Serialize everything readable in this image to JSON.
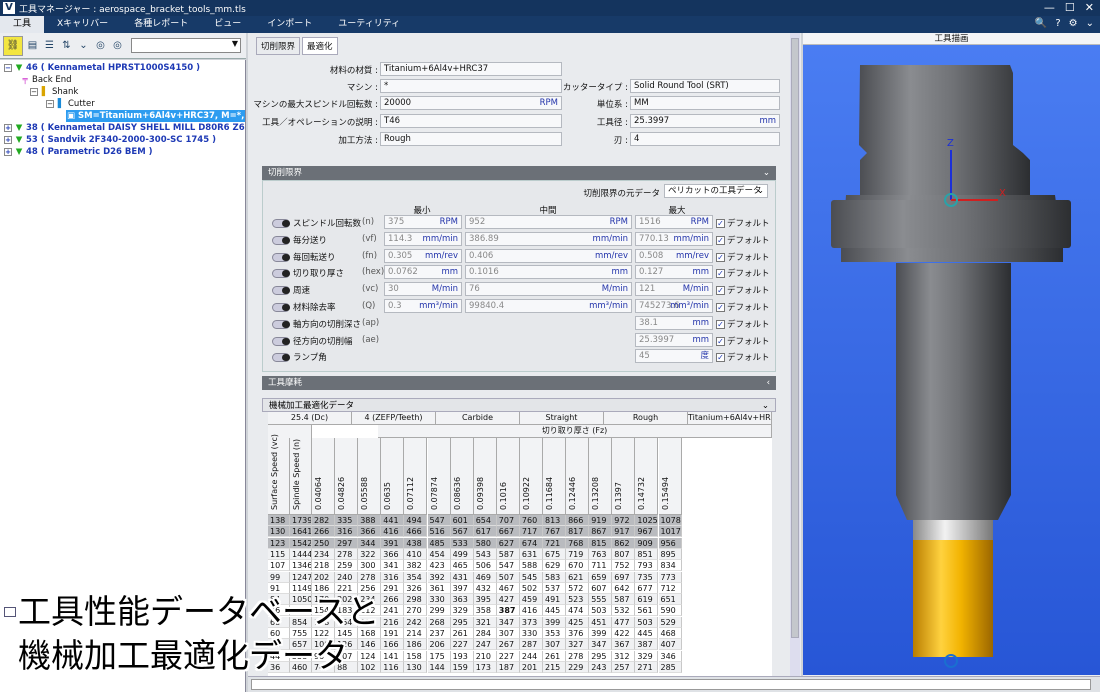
{
  "window": {
    "title": "工具マネージャー : aerospace_bracket_tools_mm.tls"
  },
  "menu": [
    "工具",
    "Xキャリバー",
    "各種レポート",
    "ビュー",
    "インポート",
    "ユーティリティ"
  ],
  "tree": [
    {
      "label": "46 ( Kennametal HPRST1000S4150 )",
      "level": 0,
      "style": "blue",
      "icon": "▼"
    },
    {
      "label": "Back End",
      "level": 1,
      "style": "",
      "icon": "╤"
    },
    {
      "label": "Shank",
      "level": 2,
      "style": "",
      "icon": "▌"
    },
    {
      "label": "Cutter",
      "level": 3,
      "style": "",
      "icon": "▌"
    },
    {
      "label": "SM=Titanium+6Al4v+HRC37, M=*, TO=T46",
      "level": 4,
      "style": "sel",
      "icon": "▣"
    },
    {
      "label": "38 ( Kennametal DAISY SHELL MILL D80R6 Z6 D27 RP120...",
      "level": 0,
      "style": "blue",
      "icon": "▼"
    },
    {
      "label": "53 ( Sandvik 2F340-2000-300-SC 1745 )",
      "level": 0,
      "style": "blue",
      "icon": "▼"
    },
    {
      "label": "48 ( Parametric D26 BEM )",
      "level": 0,
      "style": "blue",
      "icon": "▼"
    }
  ],
  "overlay": {
    "line1": "工具性能データベースと",
    "line2": "機械加工最適化データ"
  },
  "tabs": [
    "切削限界",
    "最適化"
  ],
  "form": {
    "material_label": "材料の材質 :",
    "material": "Titanium+6Al4v+HRC37",
    "machine_label": "マシン :",
    "machine": "*",
    "cutter_type_label": "カッタータイプ :",
    "cutter_type": "Solid Round Tool (SRT)",
    "max_spindle_label": "マシンの最大スピンドル回転数 :",
    "max_spindle": "20000",
    "max_spindle_unit": "RPM",
    "unit_label": "単位系 :",
    "unit": "MM",
    "desc_label": "工具／オペレーションの説明 :",
    "desc": "T46",
    "diameter_label": "工具径 :",
    "diameter": "25.3997",
    "diameter_unit": "mm",
    "method_label": "加工方法 :",
    "method": "Rough",
    "flutes_label": "刃 :",
    "flutes": "4"
  },
  "limits": {
    "title": "切削限界",
    "source_label": "切削限界の元データ",
    "source": "ペリカットの工具データ",
    "col_min": "最小",
    "col_mid": "中間",
    "col_max": "最大",
    "default_label": "デフォルト",
    "rows": [
      {
        "name": "スピンドル回転数",
        "sym": "(n)",
        "min": "375",
        "mid": "952",
        "max": "1516",
        "unit": "RPM"
      },
      {
        "name": "毎分送り",
        "sym": "(vf)",
        "min": "114.3",
        "mid": "386.89",
        "max": "770.13",
        "unit": "mm/min"
      },
      {
        "name": "毎回転送り",
        "sym": "(fn)",
        "min": "0.305",
        "mid": "0.406",
        "max": "0.508",
        "unit": "mm/rev"
      },
      {
        "name": "切り取り厚さ",
        "sym": "(hex)",
        "min": "0.0762",
        "mid": "0.1016",
        "max": "0.127",
        "unit": "mm"
      },
      {
        "name": "周速",
        "sym": "(vc)",
        "min": "30",
        "mid": "76",
        "max": "121",
        "unit": "M/min"
      },
      {
        "name": "材料除去率",
        "sym": "(Q)",
        "min": "0.3",
        "mid": "99840.4",
        "max": "745273.6",
        "unit": "mm³/min"
      },
      {
        "name": "軸方向の切削深さ",
        "sym": "(ap)",
        "min": "",
        "mid": "",
        "max": "38.1",
        "unit": "mm"
      },
      {
        "name": "径方向の切削幅",
        "sym": "(ae)",
        "min": "",
        "mid": "",
        "max": "25.3997",
        "unit": "mm"
      },
      {
        "name": "ランプ角",
        "sym": "",
        "min": "",
        "mid": "",
        "max": "45",
        "unit": "度"
      }
    ]
  },
  "wear": {
    "title": "工具摩耗"
  },
  "opt": {
    "title": "機械加工最適化データ",
    "info": [
      "25.4 (Dc)",
      "4 (ZEFP/Teeth)",
      "Carbide",
      "Straight",
      "Rough",
      "Titanium+6Al4v+HR..."
    ],
    "fz_label": "切り取り厚さ (Fz)",
    "col_vc": "Surface Speed (vc)",
    "col_n": "Spindle Speed (n)",
    "fz": [
      "0.04064",
      "0.04826",
      "0.05588",
      "0.0635",
      "0.07112",
      "0.07874",
      "0.08636",
      "0.09398",
      "0.1016",
      "0.10922",
      "0.11684",
      "0.12446",
      "0.13208",
      "0.1397",
      "0.14732",
      "0.15494"
    ],
    "rows": [
      [
        "138",
        "1739",
        "282",
        "335",
        "388",
        "441",
        "494",
        "547",
        "601",
        "654",
        "707",
        "760",
        "813",
        "866",
        "919",
        "972",
        "1025",
        "1078"
      ],
      [
        "130",
        "1641",
        "266",
        "316",
        "366",
        "416",
        "466",
        "516",
        "567",
        "617",
        "667",
        "717",
        "767",
        "817",
        "867",
        "917",
        "967",
        "1017"
      ],
      [
        "123",
        "1542",
        "250",
        "297",
        "344",
        "391",
        "438",
        "485",
        "533",
        "580",
        "627",
        "674",
        "721",
        "768",
        "815",
        "862",
        "909",
        "956"
      ],
      [
        "115",
        "1444",
        "234",
        "278",
        "322",
        "366",
        "410",
        "454",
        "499",
        "543",
        "587",
        "631",
        "675",
        "719",
        "763",
        "807",
        "851",
        "895"
      ],
      [
        "107",
        "1346",
        "218",
        "259",
        "300",
        "341",
        "382",
        "423",
        "465",
        "506",
        "547",
        "588",
        "629",
        "670",
        "711",
        "752",
        "793",
        "834"
      ],
      [
        "99",
        "1247",
        "202",
        "240",
        "278",
        "316",
        "354",
        "392",
        "431",
        "469",
        "507",
        "545",
        "583",
        "621",
        "659",
        "697",
        "735",
        "773"
      ],
      [
        "91",
        "1149",
        "186",
        "221",
        "256",
        "291",
        "326",
        "361",
        "397",
        "432",
        "467",
        "502",
        "537",
        "572",
        "607",
        "642",
        "677",
        "712"
      ],
      [
        "84",
        "1050",
        "170",
        "202",
        "234",
        "266",
        "298",
        "330",
        "363",
        "395",
        "427",
        "459",
        "491",
        "523",
        "555",
        "587",
        "619",
        "651"
      ],
      [
        "76",
        "952",
        "154",
        "183",
        "212",
        "241",
        "270",
        "299",
        "329",
        "358",
        "387",
        "416",
        "445",
        "474",
        "503",
        "532",
        "561",
        "590"
      ],
      [
        "68",
        "854",
        "138",
        "164",
        "190",
        "216",
        "242",
        "268",
        "295",
        "321",
        "347",
        "373",
        "399",
        "425",
        "451",
        "477",
        "503",
        "529"
      ],
      [
        "60",
        "755",
        "122",
        "145",
        "168",
        "191",
        "214",
        "237",
        "261",
        "284",
        "307",
        "330",
        "353",
        "376",
        "399",
        "422",
        "445",
        "468"
      ],
      [
        "52",
        "657",
        "106",
        "126",
        "146",
        "166",
        "186",
        "206",
        "227",
        "247",
        "267",
        "287",
        "307",
        "327",
        "347",
        "367",
        "387",
        "407"
      ],
      [
        "44",
        "558",
        "90",
        "107",
        "124",
        "141",
        "158",
        "175",
        "193",
        "210",
        "227",
        "244",
        "261",
        "278",
        "295",
        "312",
        "329",
        "346"
      ],
      [
        "36",
        "460",
        "74",
        "88",
        "102",
        "116",
        "130",
        "144",
        "159",
        "173",
        "187",
        "201",
        "215",
        "229",
        "243",
        "257",
        "271",
        "285"
      ]
    ]
  },
  "viewer": {
    "title": "工具描画",
    "axis_z": "Z",
    "axis_x": "X"
  }
}
